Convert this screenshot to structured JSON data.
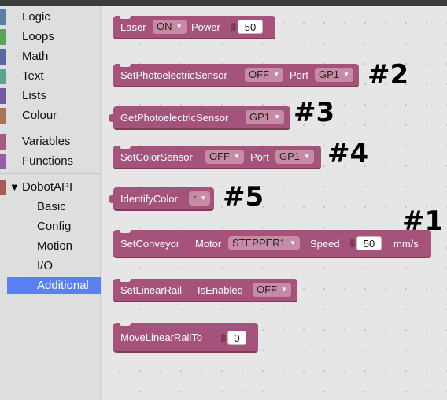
{
  "sidebar": {
    "categories": [
      {
        "label": "Logic",
        "color": "#5b80a5"
      },
      {
        "label": "Loops",
        "color": "#5ba55b"
      },
      {
        "label": "Math",
        "color": "#5b67a5"
      },
      {
        "label": "Text",
        "color": "#5ba58c"
      },
      {
        "label": "Lists",
        "color": "#745ba5"
      },
      {
        "label": "Colour",
        "color": "#a5745b"
      },
      {
        "label": "Variables",
        "color": "#a55b80"
      },
      {
        "label": "Functions",
        "color": "#995ba5"
      }
    ],
    "dobot": {
      "label": "DobotAPI",
      "color": "#a55b5b",
      "expanded_icon": "triangle-down-icon"
    },
    "subcategories": [
      {
        "label": "Basic"
      },
      {
        "label": "Config"
      },
      {
        "label": "Motion"
      },
      {
        "label": "I/O"
      },
      {
        "label": "Additional",
        "selected": true
      }
    ]
  },
  "blocks": {
    "laser": {
      "label": "Laser",
      "state": "ON",
      "power_label": "Power",
      "power": "50"
    },
    "set_photo": {
      "label": "SetPhotoelectricSensor",
      "state": "OFF",
      "port_label": "Port",
      "port": "GP1"
    },
    "get_photo": {
      "label": "GetPhotoelectricSensor",
      "port": "GP1"
    },
    "set_color": {
      "label": "SetColorSensor",
      "state": "OFF",
      "port_label": "Port",
      "port": "GP1"
    },
    "identify_color": {
      "label": "IdentifyColor",
      "color": "r"
    },
    "set_conveyor": {
      "label": "SetConveyor",
      "motor_label": "Motor",
      "motor": "STEPPER1",
      "speed_label": "Speed",
      "speed": "50",
      "unit": "mm/s"
    },
    "set_linear_rail": {
      "label": "SetLinearRail",
      "enabled_label": "IsEnabled",
      "state": "OFF"
    },
    "move_linear_rail": {
      "label": "MoveLinearRailTo",
      "value": "0"
    }
  },
  "annotations": {
    "a1": "#1",
    "a2": "#2",
    "a3": "#3",
    "a4": "#4",
    "a5": "#5"
  },
  "colors": {
    "block": "#a5537a",
    "selected": "#5b80f5"
  }
}
